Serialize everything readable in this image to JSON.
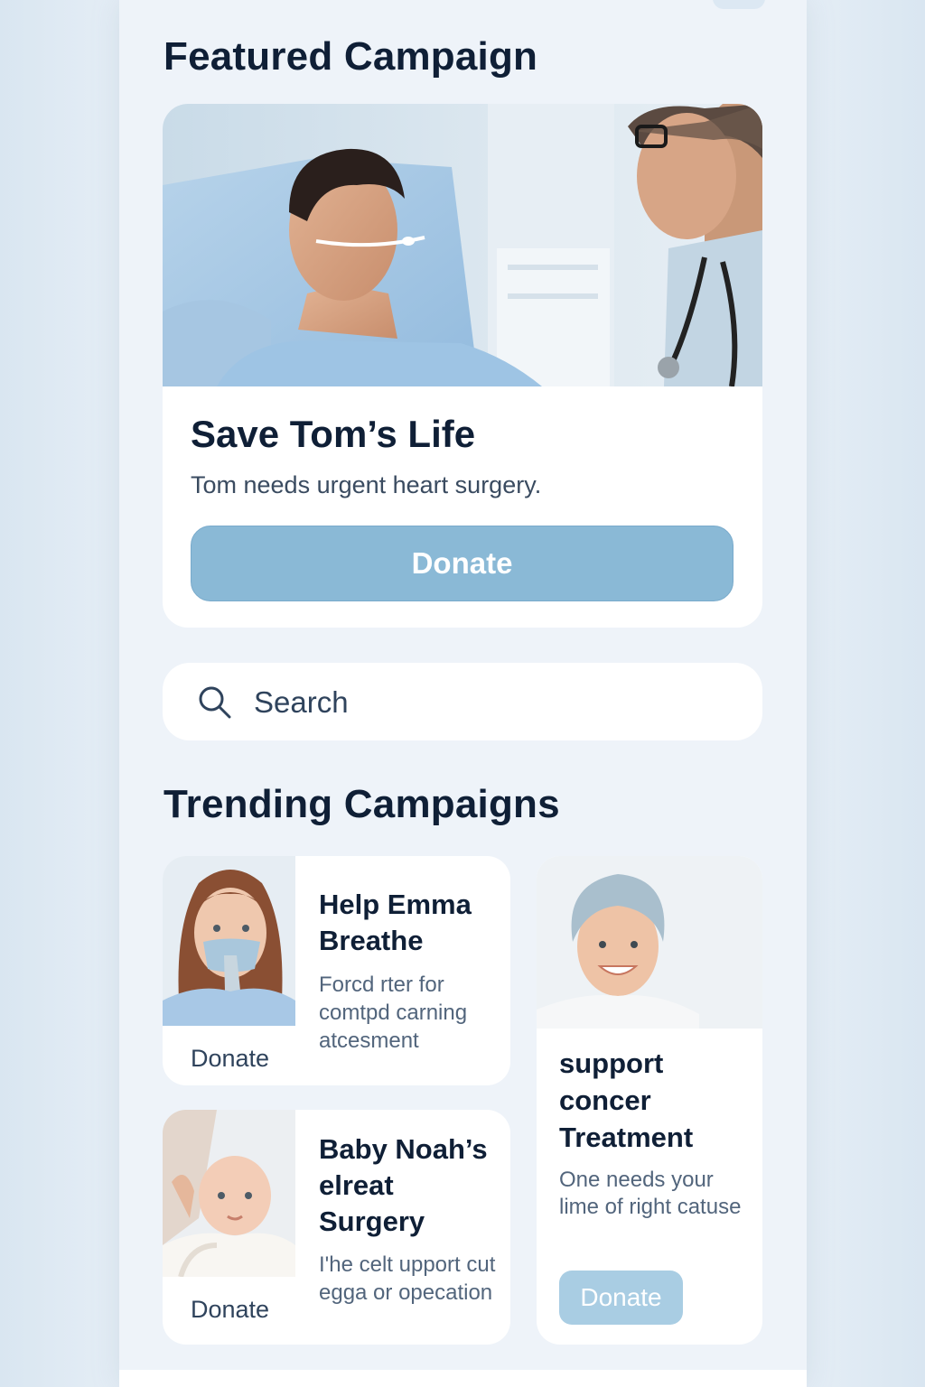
{
  "featured": {
    "section_title": "Featured Campaign",
    "title": "Save Tom’s Life",
    "subtitle": "Tom needs urgent heart surgery.",
    "donate_label": "Donate"
  },
  "search": {
    "placeholder": "Search"
  },
  "trending": {
    "section_title": "Trending Campaigns",
    "campaigns": [
      {
        "title": "Help Emma Breathe",
        "description": "Forcd rter for comtpd carning atcesment",
        "donate_label": "Donate"
      },
      {
        "title": "support concer Treatment",
        "description": "One needs your lime of right catuse",
        "donate_label": "Donate"
      },
      {
        "title": "Baby Noah’s elreat Surgery",
        "description": "I'he celt upport cut egga or opecation",
        "donate_label": "Donate"
      }
    ]
  },
  "colors": {
    "accent": "#8ab9d6",
    "accent_light": "#a9cde3",
    "title_text": "#0f1f36",
    "body_text": "#3a4b60",
    "card_bg": "#ffffff",
    "page_bg": "#eef3f9"
  },
  "icons": {
    "search": "search-icon"
  }
}
